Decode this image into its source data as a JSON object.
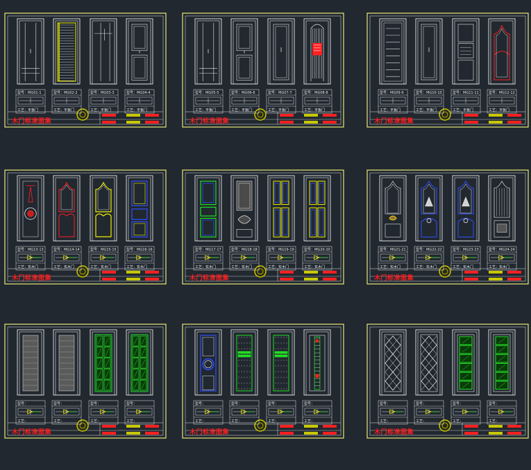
{
  "colors": {
    "background": "#212830",
    "frame": "#e8e878",
    "line": "#e8e8e8",
    "red": "#ff2020",
    "yellow": "#f0f000",
    "blue": "#3050ff",
    "green": "#20e020",
    "stamp": "#c8c800"
  },
  "sheets": [
    {
      "title": "木门标准图集",
      "doors": [
        {
          "style": "grooves",
          "code": "型号：MG01-1",
          "spec": "工艺：平板门"
        },
        {
          "style": "louver",
          "code": "型号：MG02-2",
          "spec": "工艺：平板门"
        },
        {
          "style": "cross-frame",
          "code": "型号：MG03-3",
          "spec": "工艺：平板门"
        },
        {
          "style": "two-panel",
          "code": "型号：MG04-4",
          "spec": "工艺：平板门"
        }
      ]
    },
    {
      "title": "木门标准图集",
      "doors": [
        {
          "style": "grooves",
          "code": "型号：MG05-5",
          "spec": "工艺：平板门"
        },
        {
          "style": "two-panel",
          "code": "型号：MG06-6",
          "spec": "工艺：平板门"
        },
        {
          "style": "plain-panel",
          "code": "型号：MG07-7",
          "spec": "工艺：平板门"
        },
        {
          "style": "ribbed-rounded",
          "code": "型号：MG08-8",
          "spec": "工艺：平板门"
        }
      ]
    },
    {
      "title": "木门标准图集",
      "doors": [
        {
          "style": "grooves-many",
          "code": "型号：MG09-9",
          "spec": "工艺：平板门"
        },
        {
          "style": "plain-panel",
          "code": "型号：MG10-10",
          "spec": "工艺：平板门"
        },
        {
          "style": "three-panel",
          "code": "型号：MG11-11",
          "spec": "工艺：平板门"
        },
        {
          "style": "arched-red",
          "code": "型号：MG12-12",
          "spec": "工艺：平板门"
        }
      ]
    },
    {
      "title": "木门标准图集",
      "doors": [
        {
          "style": "medallion",
          "code": "型号：MG13-13",
          "spec": "工艺：实木门"
        },
        {
          "style": "arched-red-curves",
          "code": "型号：MG14-14",
          "spec": "工艺：实木门"
        },
        {
          "style": "arched-yellow",
          "code": "型号：MG15-15",
          "spec": "工艺：实木门"
        },
        {
          "style": "blue-panels",
          "code": "型号：MG16-16",
          "spec": "工艺：实木门"
        }
      ]
    },
    {
      "title": "木门标准图集",
      "doors": [
        {
          "style": "green-panels",
          "code": "型号：MG17-17",
          "spec": "工艺：实木门"
        },
        {
          "style": "carved-gray",
          "code": "型号：MG18-18",
          "spec": "工艺：实木门"
        },
        {
          "style": "yellow-blue-panels",
          "code": "型号：MG19-19",
          "spec": "工艺：实木门"
        },
        {
          "style": "yellow-blue-panels",
          "code": "型号：MG20-20",
          "spec": "工艺：实木门"
        }
      ]
    },
    {
      "title": "木门标准图集",
      "doors": [
        {
          "style": "arched-ornament",
          "code": "型号：MG21-21",
          "spec": "工艺：实木门"
        },
        {
          "style": "arched-blue-ornament",
          "code": "型号：MG22-22",
          "spec": "工艺：实木门"
        },
        {
          "style": "arched-blue-ornament",
          "code": "型号：MG23-23",
          "spec": "工艺：实木门"
        },
        {
          "style": "arched-ribbed",
          "code": "型号：MG24-24",
          "spec": "工艺：实木门"
        }
      ]
    },
    {
      "title": "木门标准图集",
      "doors": [
        {
          "style": "gray-slats",
          "code": "型号：",
          "spec": "工艺："
        },
        {
          "style": "gray-slats",
          "code": "型号：",
          "spec": "工艺："
        },
        {
          "style": "green-grid",
          "code": "型号：",
          "spec": "工艺："
        },
        {
          "style": "green-grid",
          "code": "型号：",
          "spec": "工艺："
        }
      ]
    },
    {
      "title": "木门标准图集",
      "doors": [
        {
          "style": "circle-blue",
          "code": "型号：",
          "spec": "工艺："
        },
        {
          "style": "green-lattice-bars",
          "code": "型号：",
          "spec": "工艺："
        },
        {
          "style": "green-lattice-bars",
          "code": "型号：",
          "spec": "工艺："
        },
        {
          "style": "side-light",
          "code": "型号：",
          "spec": "工艺："
        }
      ]
    },
    {
      "title": "木门标准图集",
      "doors": [
        {
          "style": "diamond",
          "code": "型号：",
          "spec": "工艺："
        },
        {
          "style": "diamond",
          "code": "型号：",
          "spec": "工艺："
        },
        {
          "style": "green-rows",
          "code": "型号：",
          "spec": "工艺："
        },
        {
          "style": "green-rows",
          "code": "型号：",
          "spec": "工艺："
        }
      ]
    }
  ]
}
